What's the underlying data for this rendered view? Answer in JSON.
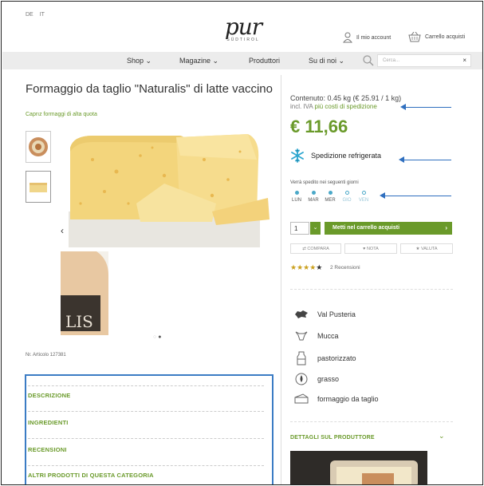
{
  "languages": [
    "DE",
    "IT"
  ],
  "logo": {
    "text": "pur",
    "sub": "SÜDTIROL"
  },
  "header": {
    "account_label": "Il mio account",
    "cart_label": "Carrello acquisti"
  },
  "nav": {
    "items": [
      "Shop",
      "Magazine",
      "Produttori",
      "Su di noi"
    ],
    "search_placeholder": "Cerca..."
  },
  "product": {
    "title": "Formaggio da taglio \"Naturalis\" di latte vaccino",
    "brand": "Caprız formaggi di alta quota",
    "sku": "Nr. Articolo 127381"
  },
  "pricing": {
    "content": "Contenuto: 0.45 kg (€ 25.91 / 1 kg)",
    "iva_prefix": "incl. IVA ",
    "iva_link": "più costi di spedizione",
    "price": "€ 11,66",
    "cold_shipping": "Spedizione refrigerata",
    "ship_days_note": "Verrà spedito nei seguenti giorni",
    "days": [
      {
        "label": "LUN",
        "active": true
      },
      {
        "label": "MAR",
        "active": true
      },
      {
        "label": "MER",
        "active": true
      },
      {
        "label": "GIO",
        "active": false
      },
      {
        "label": "VEN",
        "active": false
      }
    ]
  },
  "cart": {
    "quantity": "1",
    "add_label": "Metti nel carrello acquisti"
  },
  "actions": {
    "compare": "COMPARA",
    "note": "NOTA",
    "rate": "VALUTA"
  },
  "rating": {
    "stars": 4,
    "max": 5,
    "reviews": "2 Recensioni"
  },
  "attributes": [
    {
      "icon": "map-region-icon",
      "label": "Val Pusteria"
    },
    {
      "icon": "cow-icon",
      "label": "Mucca"
    },
    {
      "icon": "milk-bottle-icon",
      "label": "pastorizzato"
    },
    {
      "icon": "fat-drop-icon",
      "label": "grasso"
    },
    {
      "icon": "cheese-icon",
      "label": "formaggio da taglio"
    }
  ],
  "accordion": [
    "DESCRIZIONE",
    "INGREDIENTI",
    "RECENSIONI",
    "ALTRI PRODOTTI DI QUESTA CATEGORIA"
  ],
  "producer": {
    "label": "DETTAGLI SUL PRODUTTORE"
  },
  "colors": {
    "accent_green": "#6a9a2a",
    "annotation_blue": "#2f6fbf",
    "day_dot": "#4aa8c8"
  }
}
